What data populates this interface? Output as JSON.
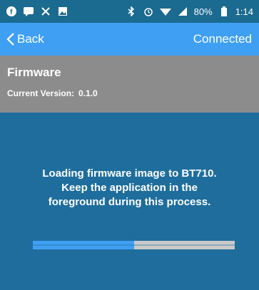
{
  "status_bar": {
    "battery_percent": "80%",
    "time": "1:14",
    "icons_left": [
      "facebook-icon",
      "message-icon",
      "tools-icon",
      "image-icon"
    ],
    "icons_right": [
      "bluetooth-icon",
      "alarm-icon",
      "wifi-icon",
      "signal-icon",
      "battery-icon"
    ]
  },
  "nav": {
    "back_label": "Back",
    "connection_status": "Connected"
  },
  "firmware": {
    "title": "Firmware",
    "version_label": "Current Version:",
    "version_value": "0.1.0"
  },
  "message": {
    "line1": "Loading firmware image to BT710.",
    "line2": "Keep the application in the",
    "line3": "foreground during this process."
  },
  "progress": {
    "fraction": 0.5
  },
  "colors": {
    "nav_bg": "#3f9ff2",
    "status_bg": "#1b6a8f",
    "main_bg": "#1e6d9c",
    "header_bg": "#8c8c8c",
    "progress_fill": "#3f9ff2",
    "progress_track": "#c9c9c9"
  }
}
